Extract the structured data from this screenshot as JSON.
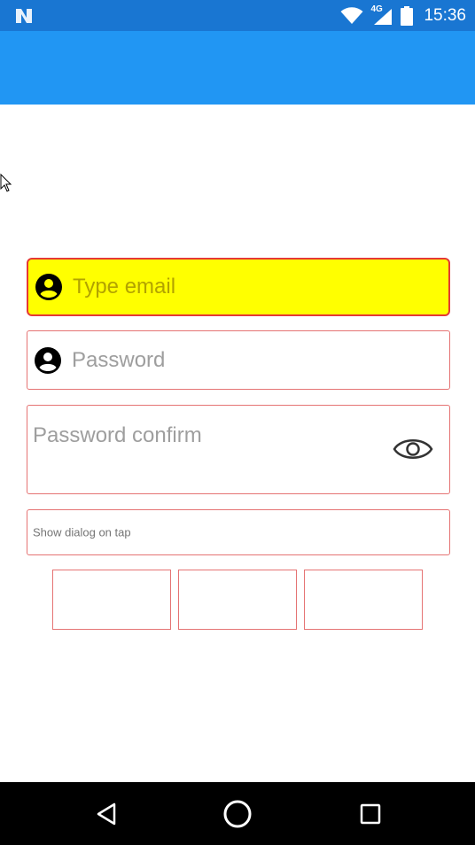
{
  "status_bar": {
    "time": "15:36",
    "network_label": "4G",
    "icons": [
      "notification-n-icon",
      "wifi-icon",
      "signal-icon",
      "battery-icon"
    ]
  },
  "form": {
    "email_placeholder": "Type email",
    "password_placeholder": "Password",
    "password_confirm_placeholder": "Password confirm",
    "dialog_field_text": "Show dialog on tap"
  },
  "colors": {
    "status_bar": "#1976D2",
    "app_bar": "#2196F3",
    "email_background": "#FFFF00",
    "field_border": "#E57373"
  },
  "nav_bar": {
    "icons": [
      "back-icon",
      "home-icon",
      "recents-icon"
    ]
  }
}
